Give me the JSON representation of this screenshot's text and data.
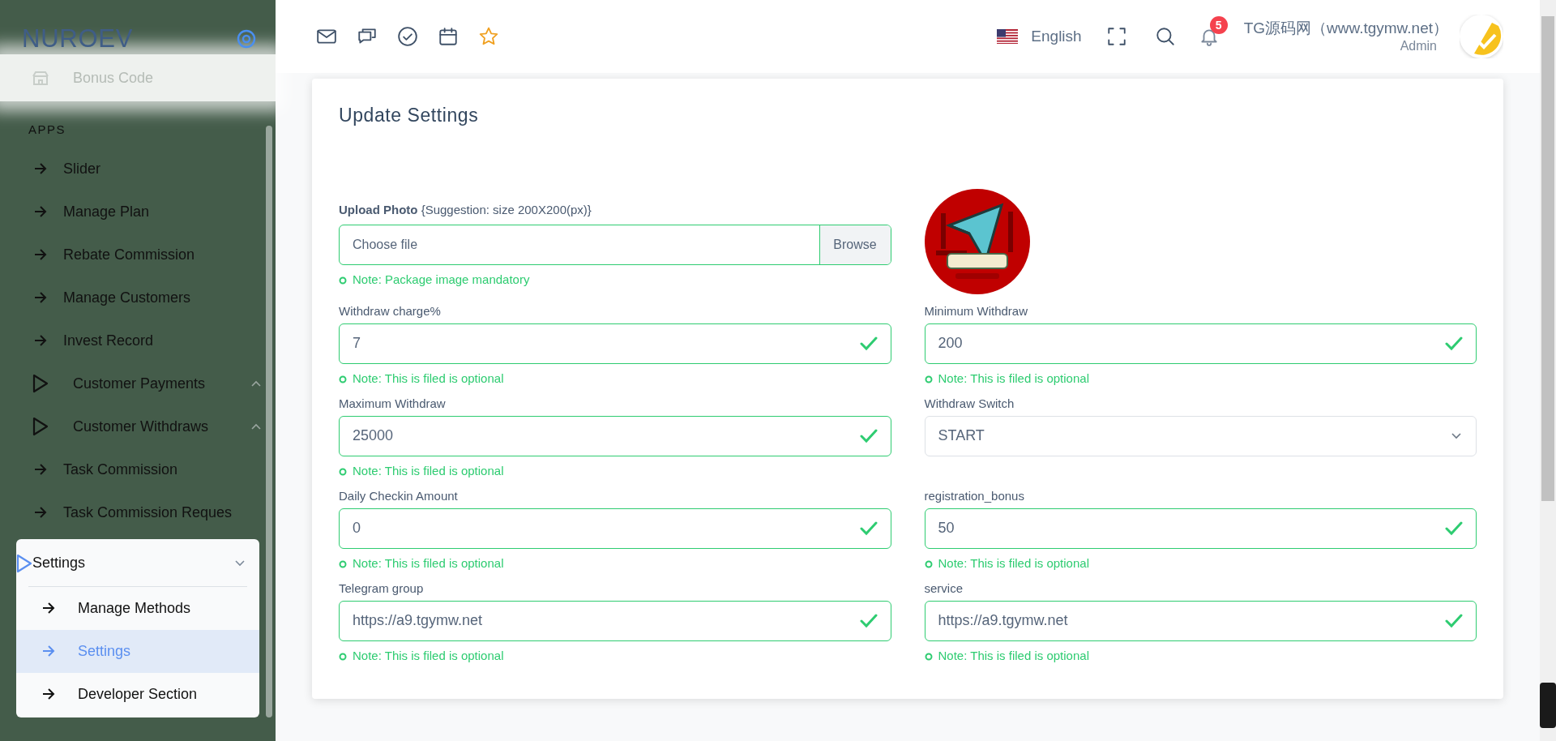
{
  "sidebar": {
    "logo": "NUROEV",
    "obscured_item": {
      "label": "Bonus Code"
    },
    "section": "APPS",
    "items": [
      {
        "kind": "link",
        "label": "Slider"
      },
      {
        "kind": "link",
        "label": "Manage Plan"
      },
      {
        "kind": "link",
        "label": "Rebate Commission"
      },
      {
        "kind": "link",
        "label": "Manage Customers"
      },
      {
        "kind": "link",
        "label": "Invest Record"
      },
      {
        "kind": "group",
        "label": "Customer Payments",
        "expanded": false
      },
      {
        "kind": "group",
        "label": "Customer Withdraws",
        "expanded": false
      },
      {
        "kind": "link",
        "label": "Task Commission"
      },
      {
        "kind": "link",
        "label": "Task Commission Reques"
      },
      {
        "kind": "group",
        "label": "Settings",
        "expanded": true,
        "children": [
          {
            "label": "Manage Methods",
            "selected": false
          },
          {
            "label": "Settings",
            "selected": true
          },
          {
            "label": "Developer Section",
            "selected": false
          }
        ]
      }
    ]
  },
  "topbar": {
    "language": "English",
    "notifications": "5",
    "user_name": "TG源码网（www.tgymw.net）",
    "user_role": "Admin"
  },
  "card": {
    "title": "Update Settings",
    "upload": {
      "label": "**Upload Photo** {Suggestion: size 200X200(px)}",
      "placeholder": "Choose file",
      "button": "Browse",
      "note": "Note: Package image mandatory"
    },
    "fields": [
      {
        "kind": "text",
        "label": "Withdraw charge%",
        "value": "7",
        "note": "Note: This is filed is optional"
      },
      {
        "kind": "text",
        "label": "Minimum Withdraw",
        "value": "200",
        "note": "Note: This is filed is optional"
      },
      {
        "kind": "text",
        "label": "Maximum Withdraw",
        "value": "25000",
        "note": "Note: This is filed is optional"
      },
      {
        "kind": "select",
        "label": "Withdraw Switch",
        "value": "START"
      },
      {
        "kind": "text",
        "label": "Daily Checkin Amount",
        "value": "0",
        "note": "Note: This is filed is optional"
      },
      {
        "kind": "text",
        "label": "registration_bonus",
        "value": "50",
        "note": "Note: This is filed is optional"
      },
      {
        "kind": "text",
        "label": "Telegram group",
        "value": "https://a9.tgymw.net",
        "note": "Note: This is filed is optional"
      },
      {
        "kind": "text",
        "label": "service",
        "value": "https://a9.tgymw.net",
        "note": "Note: This is filed is optional"
      }
    ]
  }
}
